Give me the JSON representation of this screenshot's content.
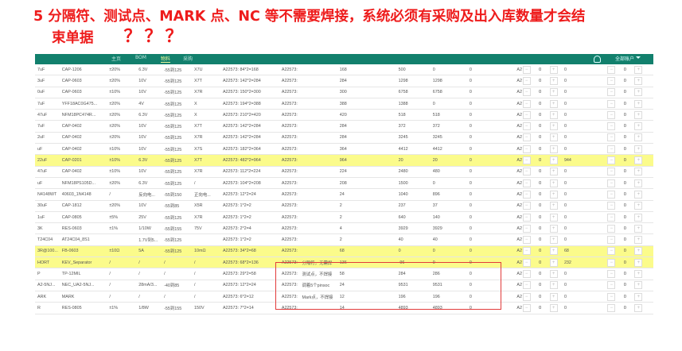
{
  "annotation": {
    "line1": "5 分隔符、测试点、MARK 点、NC 等不需要焊接，系统必须有采购及出入库数量才会结",
    "line2": "束单据",
    "marks": "？？？",
    "color": "#ee1c1c"
  },
  "app": {
    "header_color": "#12806d",
    "tabs": [
      "主页",
      "BOM",
      "物料",
      "采购"
    ],
    "active_tab": 2,
    "user_label": "全部账户"
  },
  "table": {
    "highlight_color": "#fbfb8b",
    "rows": [
      {
        "c": [
          "7uF",
          "CAP-1206",
          "±20%",
          "6.3V",
          "-55到125",
          "X7U",
          "A22573: 84*2=168",
          "A22573:",
          "",
          "168",
          "500",
          "0",
          "0",
          "A2"
        ],
        "a": "0",
        "b": "0",
        "hl": false
      },
      {
        "c": [
          "3uF",
          "CAP-0603",
          "±20%",
          "10V",
          "-55到125",
          "X7T",
          "A22573: 142*2=284",
          "A22573:",
          "",
          "284",
          "1298",
          "1298",
          "0",
          "A2"
        ],
        "a": "0",
        "b": "0",
        "hl": false
      },
      {
        "c": [
          "0uF",
          "CAP-0603",
          "±10%",
          "10V",
          "-55到125",
          "X7R",
          "A22573: 150*2=300",
          "A22573:",
          "",
          "300",
          "6758",
          "6758",
          "0",
          "A2"
        ],
        "a": "0",
        "b": "0",
        "hl": false
      },
      {
        "c": [
          "7uF",
          "YFF18AC0G475...",
          "±20%",
          "4V",
          "-55到125",
          "X",
          "A22573: 194*2=388",
          "A22573:",
          "",
          "388",
          "1388",
          "0",
          "0",
          "A2"
        ],
        "a": "0",
        "b": "0",
        "hl": false
      },
      {
        "c": [
          "47uF",
          "NFM18PC474R...",
          "±20%",
          "6.3V",
          "-55到125",
          "X",
          "A22573: 210*2=420",
          "A22573:",
          "",
          "420",
          "518",
          "518",
          "0",
          "A2"
        ],
        "a": "0",
        "b": "0",
        "hl": false
      },
      {
        "c": [
          "7uF",
          "CAP-0402",
          "±20%",
          "10V",
          "-55到125",
          "X7T",
          "A22573: 142*2=284",
          "A22573:",
          "",
          "284",
          "372",
          "372",
          "0",
          "A2"
        ],
        "a": "0",
        "b": "0",
        "hl": false
      },
      {
        "c": [
          "2uF",
          "CAP-0402",
          "±20%",
          "10V",
          "-55到125",
          "X7R",
          "A22573: 142*2=284",
          "A22573:",
          "",
          "284",
          "3245",
          "3245",
          "0",
          "A2"
        ],
        "a": "0",
        "b": "0",
        "hl": false
      },
      {
        "c": [
          "uF",
          "CAP-0402",
          "±10%",
          "10V",
          "-55到125",
          "X7S",
          "A22573: 182*2=364",
          "A22573:",
          "",
          "364",
          "4412",
          "4412",
          "0",
          "A2"
        ],
        "a": "0",
        "b": "0",
        "hl": false
      },
      {
        "c": [
          "22uF",
          "CAP-0201",
          "±10%",
          "6.3V",
          "-55到125",
          "X7T",
          "A22573: 482*2=964",
          "A22573:",
          "",
          "964",
          "20",
          "20",
          "0",
          "A2"
        ],
        "a": "0",
        "b": "944",
        "hl": true
      },
      {
        "c": [
          "47uF",
          "CAP-0402",
          "±10%",
          "10V",
          "-55到125",
          "X7R",
          "A22573: 112*2=224",
          "A22573:",
          "",
          "224",
          "2480",
          "480",
          "0",
          "A2"
        ],
        "a": "0",
        "b": "0",
        "hl": false
      },
      {
        "c": [
          "uF",
          "NFM18PS105D...",
          "±20%",
          "6.3V",
          "-55到125",
          "/",
          "A22573: 104*2=208",
          "A22573:",
          "",
          "208",
          "1500",
          "0",
          "0",
          "A2"
        ],
        "a": "0",
        "b": "0",
        "hl": false
      },
      {
        "c": [
          "N4148WT",
          "40603_1N4148",
          "/",
          "反向电...",
          "-55到150",
          "正向电...",
          "A22573: 12*2=24",
          "A22573:",
          "",
          "24",
          "1040",
          "896",
          "0",
          "A2"
        ],
        "a": "0",
        "b": "0",
        "hl": false
      },
      {
        "c": [
          "30uF",
          "CAP-1812",
          "±20%",
          "10V",
          "-55到85",
          "X5R",
          "A22573: 1*2=2",
          "A22573:",
          "",
          "2",
          "237",
          "37",
          "0",
          "A2"
        ],
        "a": "0",
        "b": "0",
        "hl": false
      },
      {
        "c": [
          "1uF",
          "CAP-0805",
          "±5%",
          "25V",
          "-55到125",
          "X7R",
          "A22573: 1*2=2",
          "A22573:",
          "",
          "2",
          "640",
          "140",
          "0",
          "A2"
        ],
        "a": "0",
        "b": "0",
        "hl": false
      },
      {
        "c": [
          "3K",
          "RES-0603",
          "±1%",
          "1/10W",
          "-55到155",
          "75V",
          "A22573: 2*2=4",
          "A22573:",
          "",
          "4",
          "3929",
          "3929",
          "0",
          "A2"
        ],
        "a": "0",
        "b": "0",
        "hl": false
      },
      {
        "c": [
          "T24C04",
          "AT24C04_8S1",
          "",
          "1.7V到5...",
          "-55到125",
          "",
          "A22573: 1*2=2",
          "A22573:",
          "",
          "2",
          "40",
          "40",
          "0",
          "A2"
        ],
        "a": "0",
        "b": "0",
        "hl": false
      },
      {
        "c": [
          "3R@100...",
          "FB-0603",
          "±10Ω",
          "5A",
          "-55到125",
          "10mΩ",
          "A22573: 34*2=68",
          "A22573:",
          "",
          "68",
          "0",
          "0",
          "0",
          "A2"
        ],
        "a": "0",
        "b": "68",
        "hl": true
      },
      {
        "c": [
          "HORT",
          "KEV_Separator",
          "/",
          "/",
          "/",
          "/",
          "A22573: 68*2=136",
          "A22573:",
          "分隔符，无需焊",
          "136",
          "-96",
          "0",
          "0",
          "A2"
        ],
        "a": "0",
        "b": "232",
        "hl": true
      },
      {
        "c": [
          "P",
          "TP-12MIL",
          "/",
          "/",
          "/",
          "/",
          "A22573: 29*2=58",
          "A22573:",
          "测试点，不焊接",
          "58",
          "284",
          "286",
          "0",
          "A2"
        ],
        "a": "0",
        "b": "0",
        "hl": false
      },
      {
        "c": [
          "A2-5NJ...",
          "NEC_UA2-5NJ...",
          "/",
          "28mA/3...",
          "-40到85",
          "/",
          "A22573: 12*2=24",
          "A22573:",
          "调着5个pinsoc",
          "24",
          "9531",
          "9531",
          "0",
          "A2"
        ],
        "a": "0",
        "b": "0",
        "hl": false
      },
      {
        "c": [
          "ARK",
          "MARK",
          "/",
          "/",
          "/",
          "/",
          "A22573: 6*2=12",
          "A22573:",
          "Mark点，不焊接",
          "12",
          "196",
          "196",
          "0",
          "A2"
        ],
        "a": "0",
        "b": "0",
        "hl": false
      },
      {
        "c": [
          "R",
          "RES-0805",
          "±1%",
          "1/8W",
          "-55到155",
          "150V",
          "A22573: 7*2=14",
          "A22573:",
          "",
          "14",
          "4893",
          "4893",
          "0",
          "A2"
        ],
        "a": "0",
        "b": "0",
        "hl": false
      }
    ]
  }
}
